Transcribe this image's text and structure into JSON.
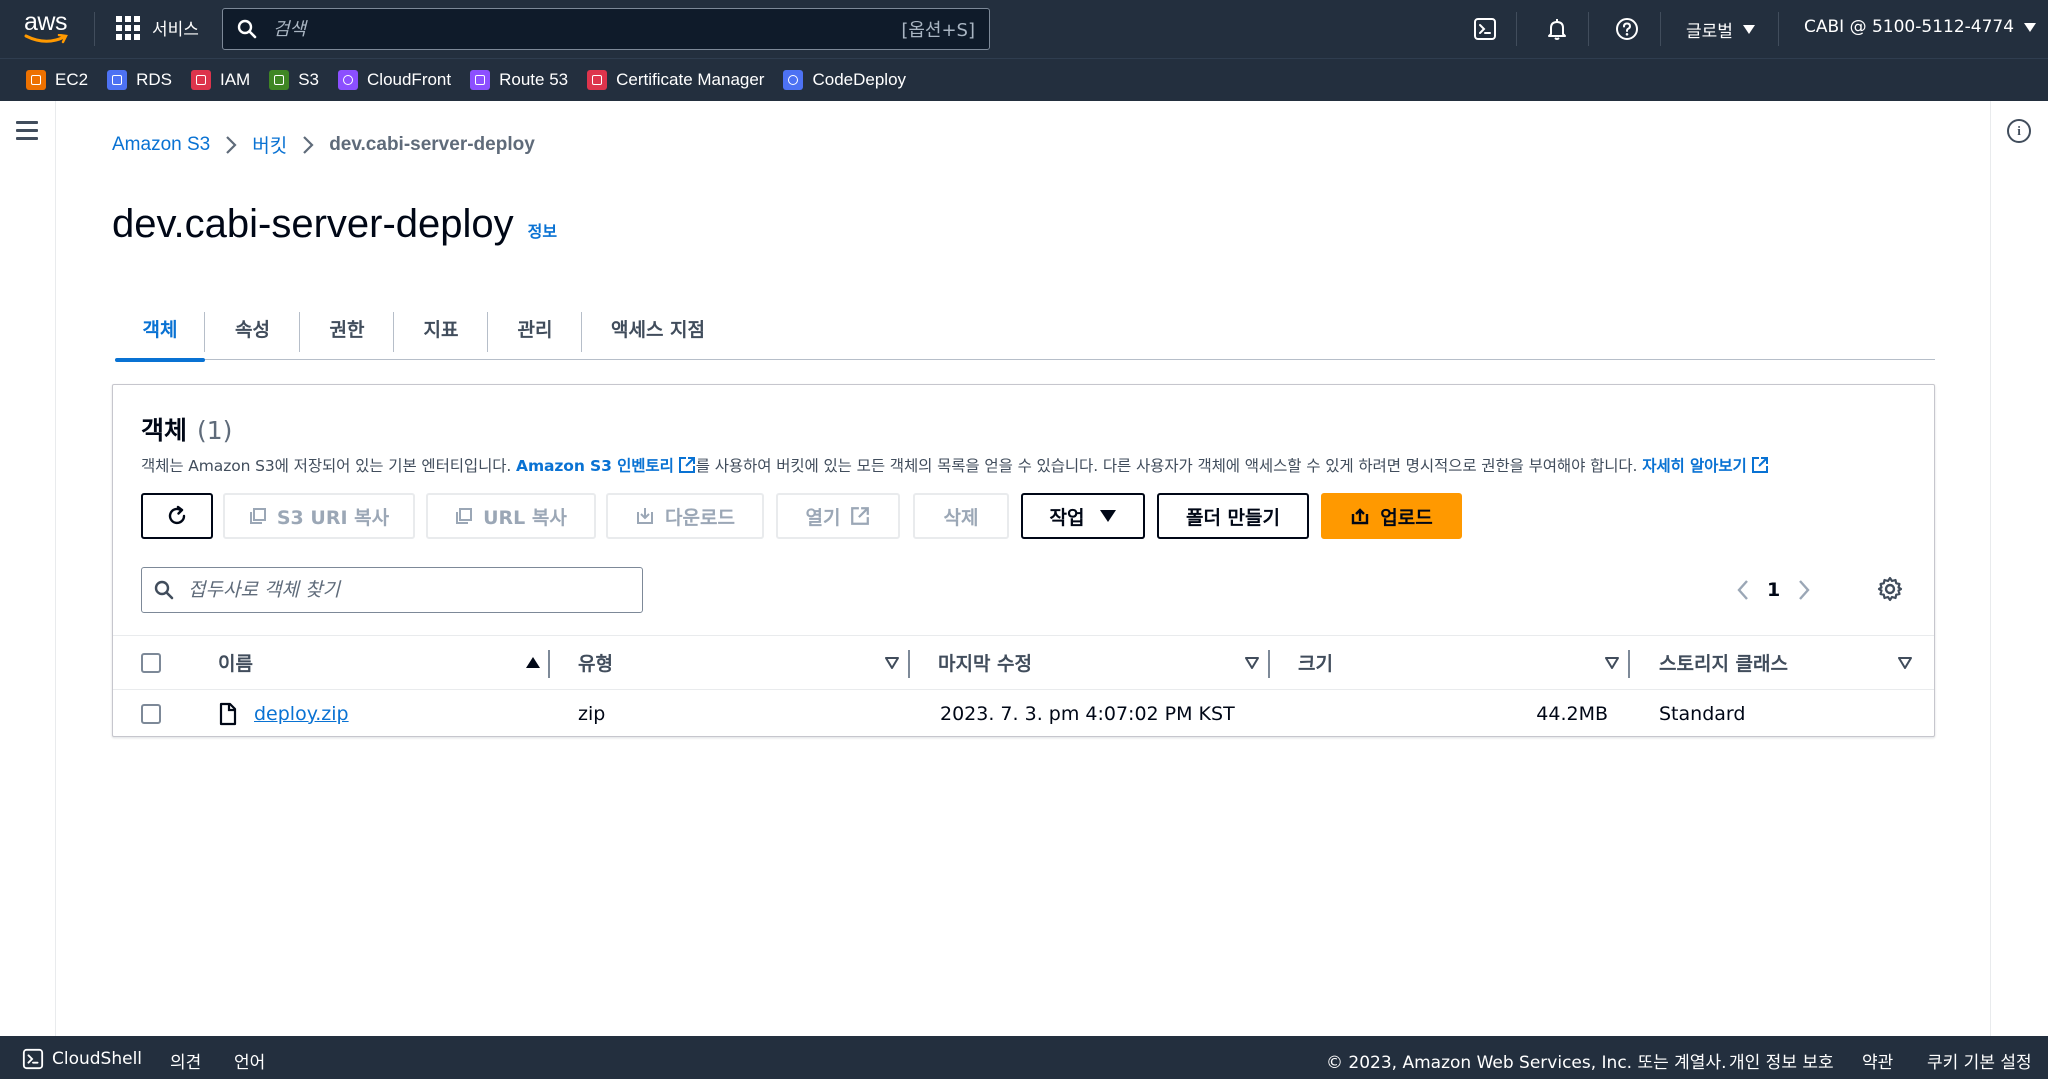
{
  "topnav": {
    "logo_text": "aws",
    "services_label": "서비스",
    "search_placeholder": "검색",
    "search_shortcut": "[옵션+S]",
    "region_label": "글로벌",
    "account_label": "CABI @ 5100-5112-4774"
  },
  "favorites": [
    {
      "label": "EC2",
      "color": "#ed7100"
    },
    {
      "label": "RDS",
      "color": "#4d72f3"
    },
    {
      "label": "IAM",
      "color": "#dd344c"
    },
    {
      "label": "S3",
      "color": "#3f8624"
    },
    {
      "label": "CloudFront",
      "color": "#8c4fff"
    },
    {
      "label": "Route 53",
      "color": "#8c4fff"
    },
    {
      "label": "Certificate Manager",
      "color": "#dd344c"
    },
    {
      "label": "CodeDeploy",
      "color": "#4d72f3"
    }
  ],
  "breadcrumb": {
    "root": "Amazon S3",
    "middle": "버킷",
    "current": "dev.cabi-server-deploy"
  },
  "page": {
    "title": "dev.cabi-server-deploy",
    "info_link": "정보"
  },
  "tabs": [
    {
      "label": "객체",
      "active": true
    },
    {
      "label": "속성"
    },
    {
      "label": "권한"
    },
    {
      "label": "지표"
    },
    {
      "label": "관리"
    },
    {
      "label": "액세스 지점"
    }
  ],
  "objects_panel": {
    "heading": "객체",
    "count": "(1)",
    "desc_part1": "객체는 Amazon S3에 저장되어 있는 기본 엔터티입니다. ",
    "desc_link1": "Amazon S3 인벤토리",
    "desc_part2": "를 사용하여 버킷에 있는 모든 객체의 목록을 얻을 수 있습니다. 다른 사용자가 객체에 액세스할 수 있게 하려면 명시적으로 권한을 부여해야 합니다. ",
    "desc_link2": "자세히 알아보기",
    "buttons": {
      "copy_s3_uri": "S3 URI 복사",
      "copy_url": "URL 복사",
      "download": "다운로드",
      "open": "열기",
      "delete": "삭제",
      "actions": "작업",
      "create_folder": "폴더 만들기",
      "upload": "업로드"
    },
    "filter_placeholder": "접두사로 객체 찾기",
    "page_number": "1",
    "columns": [
      "이름",
      "유형",
      "마지막 수정",
      "크기",
      "스토리지 클래스"
    ],
    "rows": [
      {
        "name": "deploy.zip",
        "type": "zip",
        "last_modified": "2023. 7. 3. pm 4:07:02 PM KST",
        "size": "44.2MB",
        "storage_class": "Standard"
      }
    ]
  },
  "footer": {
    "cloudshell": "CloudShell",
    "feedback": "의견",
    "language": "언어",
    "copyright": "© 2023, Amazon Web Services, Inc. 또는 계열사.",
    "privacy": "개인 정보 보호",
    "terms": "약관",
    "cookies": "쿠키 기본 설정"
  },
  "colors": {
    "nav_bg": "#232f3e",
    "link": "#0972d3",
    "primary_button": "#ff9900"
  }
}
